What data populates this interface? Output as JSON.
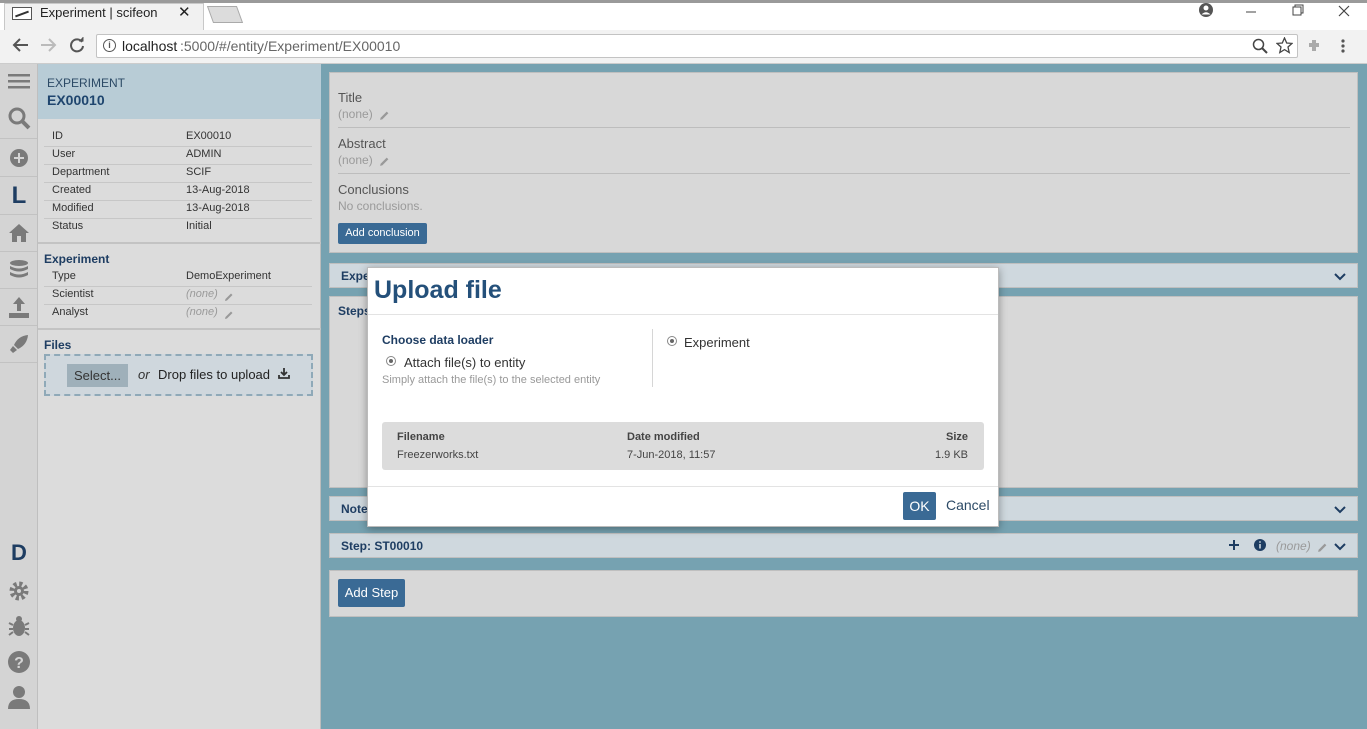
{
  "browser": {
    "tab_title": "Experiment | scifeon",
    "tab_close": "✕",
    "url_host": "localhost",
    "url_path": ":5000/#/entity/Experiment/EX00010"
  },
  "rail": {
    "letter_l": "L",
    "letter_d": "D"
  },
  "left_panel": {
    "type_label": "EXPERIMENT",
    "entity_id": "EX00010",
    "properties": [
      {
        "key": "ID",
        "value": "EX00010"
      },
      {
        "key": "User",
        "value": "ADMIN"
      },
      {
        "key": "Department",
        "value": "SCIF"
      },
      {
        "key": "Created",
        "value": "13-Aug-2018"
      },
      {
        "key": "Modified",
        "value": "13-Aug-2018"
      },
      {
        "key": "Status",
        "value": "Initial"
      }
    ],
    "experiment_section": {
      "title": "Experiment",
      "fields": [
        {
          "key": "Type",
          "value": "DemoExperiment"
        },
        {
          "key": "Scientist",
          "value": "(none)"
        },
        {
          "key": "Analyst",
          "value": "(none)"
        }
      ]
    },
    "files_section": {
      "title": "Files",
      "select_label": "Select...",
      "or_label": "or",
      "drop_label": "Drop files to upload"
    }
  },
  "main": {
    "title_label": "Title",
    "title_value": "(none)",
    "abstract_label": "Abstract",
    "abstract_value": "(none)",
    "conclusions_label": "Conclusions",
    "conclusions_value": "No conclusions.",
    "add_conclusion": "Add conclusion",
    "experiment_header": "Expe",
    "steps_header": "Steps",
    "notes_header": "Note",
    "step_header": "Step: ST00010",
    "step_value": "(none)",
    "add_step": "Add Step"
  },
  "modal": {
    "title": "Upload file",
    "choose_loader_label": "Choose data loader",
    "loader_option": "Attach file(s) to entity",
    "loader_desc": "Simply attach the file(s) to the selected entity",
    "target_option": "Experiment",
    "table": {
      "headers": {
        "filename": "Filename",
        "date_modified": "Date modified",
        "size": "Size"
      },
      "rows": [
        {
          "filename": "Freezerworks.txt",
          "date_modified": "7-Jun-2018, 11:57",
          "size": "1.9 KB"
        }
      ]
    },
    "ok_label": "OK",
    "cancel_label": "Cancel"
  }
}
